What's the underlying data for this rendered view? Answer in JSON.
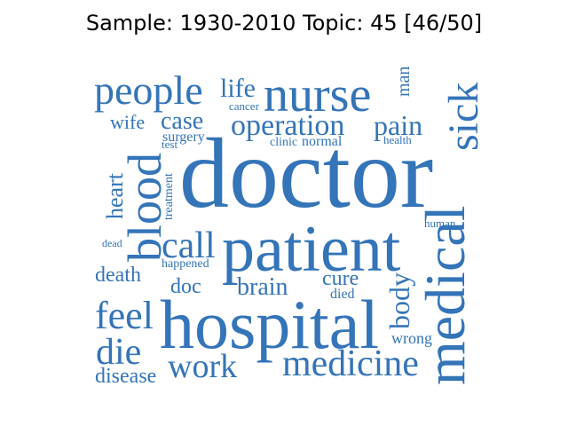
{
  "title": "Sample: 1930-2010 Topic: 45 [46/50]",
  "color": "#3474b8",
  "words": [
    {
      "text": "doctor"
    },
    {
      "text": "patient"
    },
    {
      "text": "hospital"
    },
    {
      "text": "nurse"
    },
    {
      "text": "people"
    },
    {
      "text": "medical"
    },
    {
      "text": "medicine"
    },
    {
      "text": "blood"
    },
    {
      "text": "sick"
    },
    {
      "text": "feel"
    },
    {
      "text": "die"
    },
    {
      "text": "work"
    },
    {
      "text": "operation"
    },
    {
      "text": "call"
    },
    {
      "text": "life"
    },
    {
      "text": "case"
    },
    {
      "text": "pain"
    },
    {
      "text": "brain"
    },
    {
      "text": "body"
    },
    {
      "text": "heart"
    },
    {
      "text": "death"
    },
    {
      "text": "cure"
    },
    {
      "text": "disease"
    },
    {
      "text": "doc"
    },
    {
      "text": "wife"
    },
    {
      "text": "man"
    },
    {
      "text": "surgery"
    },
    {
      "text": "wrong"
    },
    {
      "text": "normal"
    },
    {
      "text": "clinic"
    },
    {
      "text": "treatment"
    },
    {
      "text": "happened"
    },
    {
      "text": "died"
    },
    {
      "text": "health"
    },
    {
      "text": "human"
    },
    {
      "text": "cancer"
    },
    {
      "text": "test"
    },
    {
      "text": "dead"
    }
  ]
}
